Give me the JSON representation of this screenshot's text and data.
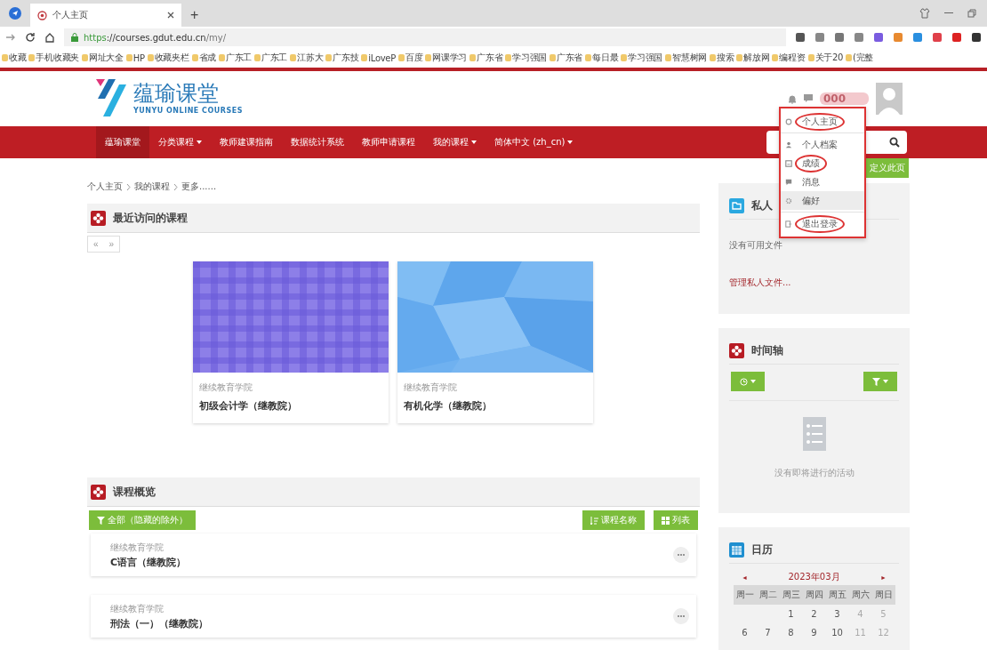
{
  "browser": {
    "tabs": [
      {
        "title": "个人主页",
        "selected": true
      }
    ],
    "new_tab": "+",
    "url_scheme": "https",
    "url_rest": "://courses.gdut.edu.cn",
    "url_path": "/my/",
    "bookmarks": [
      "收藏",
      "手机收藏夹",
      "网址大全",
      "HP",
      "收藏夹栏",
      "省成",
      "广东工",
      "广东工",
      "江苏大",
      "广东技",
      "iLoveP",
      "百度",
      "网课学习",
      "广东省",
      "学习强国",
      "广东省",
      "每日最",
      "学习强国",
      "智慧树网",
      "搜索",
      "解放网",
      "编程资",
      "关于20",
      "(完整"
    ]
  },
  "header": {
    "logo_title": "蕴瑜课堂",
    "logo_subtitle": "YUNYU ONLINE COURSES",
    "user_name": "000"
  },
  "nav": [
    {
      "label": "蕴瑜课堂",
      "selected": true,
      "dropdown": false
    },
    {
      "label": "分类课程",
      "selected": false,
      "dropdown": true
    },
    {
      "label": "教师建课指南",
      "selected": false,
      "dropdown": false
    },
    {
      "label": "数据统计系统",
      "selected": false,
      "dropdown": false
    },
    {
      "label": "教师申请课程",
      "selected": false,
      "dropdown": false
    },
    {
      "label": "我的课程",
      "selected": false,
      "dropdown": true
    },
    {
      "label": "简体中文 (zh_cn)",
      "selected": false,
      "dropdown": true
    }
  ],
  "user_menu": [
    {
      "label": "个人主页",
      "kind": "dashboard",
      "selected": false,
      "circled": true
    },
    {
      "label": "个人档案",
      "kind": "profile",
      "selected": false,
      "circled": false
    },
    {
      "label": "成绩",
      "kind": "grades",
      "selected": false,
      "circled": true
    },
    {
      "label": "消息",
      "kind": "messages",
      "selected": false,
      "circled": false
    },
    {
      "label": "偏好",
      "kind": "preferences",
      "selected": true,
      "circled": false
    },
    {
      "label": "退出登录",
      "kind": "logout",
      "selected": false,
      "circled": true
    }
  ],
  "breadcrumb": [
    "个人主页",
    "我的课程",
    "更多......"
  ],
  "customize": "定义此页",
  "recent": {
    "title": "最近访问的课程",
    "pager": [
      "«",
      "»"
    ],
    "courses": [
      {
        "category": "继续教育学院",
        "name": "初级会计学（继教院）",
        "kind": "plaid"
      },
      {
        "category": "继续教育学院",
        "name": "有机化学（继教院）",
        "kind": "polygons"
      }
    ]
  },
  "overview": {
    "title": "课程概览",
    "filter": "全部（隐藏的除外）",
    "sort": "课程名称",
    "view": "列表",
    "courses": [
      {
        "category": "继续教育学院",
        "name": "C语言（继教院）"
      },
      {
        "category": "继续教育学院",
        "name": "刑法（一）（继教院）"
      }
    ]
  },
  "private_files": {
    "title": "私人",
    "empty": "没有可用文件",
    "manage": "管理私人文件..."
  },
  "timeline": {
    "title": "时间轴",
    "empty": "没有即将进行的活动"
  },
  "calendar": {
    "title": "日历",
    "prev": "◄",
    "month": "2023年03月",
    "next": "►",
    "weekdays": [
      "周一",
      "周二",
      "周三",
      "周四",
      "周五",
      "周六",
      "周日"
    ],
    "weeks": [
      [
        "1",
        "2",
        "3",
        "4",
        "5"
      ],
      [
        "6",
        "7",
        "8",
        "9",
        "10",
        "11",
        "12"
      ]
    ]
  }
}
